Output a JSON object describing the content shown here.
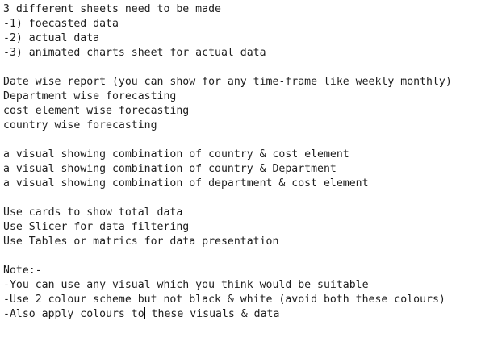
{
  "document": {
    "lines": [
      "3 different sheets need to be made",
      "-1) foecasted data",
      "-2) actual data",
      "-3) animated charts sheet for actual data",
      "",
      "Date wise report (you can show for any time-frame like weekly monthly)",
      "Department wise forecasting",
      "cost element wise forecasting",
      "country wise forecasting",
      "",
      "a visual showing combination of country & cost element",
      "a visual showing combination of country & Department",
      "a visual showing combination of department & cost element",
      "",
      "Use cards to show total data",
      "Use Slicer for data filtering",
      "Use Tables or matrics for data presentation",
      "",
      "Note:-",
      "-You can use any visual which you think would be suitable",
      "-Use 2 colour scheme but not black & white (avoid both these colours)",
      "-Also apply colours to",
      " these visuals & data"
    ]
  }
}
